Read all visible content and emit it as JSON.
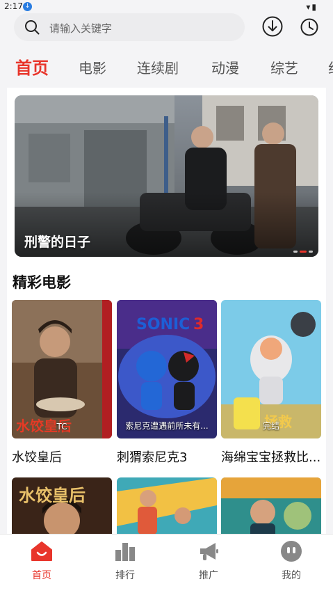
{
  "status_bar": {
    "time": "2:17"
  },
  "search": {
    "placeholder": "请输入关键字"
  },
  "tabs": [
    {
      "label": "首页",
      "active": true
    },
    {
      "label": "电影",
      "active": false
    },
    {
      "label": "连续剧",
      "active": false
    },
    {
      "label": "动漫",
      "active": false
    },
    {
      "label": "综艺",
      "active": false
    },
    {
      "label": "纪",
      "active": false
    }
  ],
  "banner": {
    "title": "刑警的日子",
    "slide_index": 2,
    "slide_count": 3
  },
  "section": {
    "title": "精彩电影"
  },
  "movies": [
    {
      "title": "水饺皇后",
      "badge": "TC"
    },
    {
      "title": "刺猬索尼克3",
      "badge": "索尼克遭遇前所未有..."
    },
    {
      "title": "海绵宝宝拯救比...",
      "badge": "完结"
    }
  ],
  "bottom_nav": [
    {
      "label": "首页",
      "icon": "home-icon",
      "active": true
    },
    {
      "label": "排行",
      "icon": "ranking-icon",
      "active": false
    },
    {
      "label": "推广",
      "icon": "megaphone-icon",
      "active": false
    },
    {
      "label": "我的",
      "icon": "profile-icon",
      "active": false
    }
  ],
  "colors": {
    "accent": "#e8352b",
    "background": "#f4f4f6"
  }
}
